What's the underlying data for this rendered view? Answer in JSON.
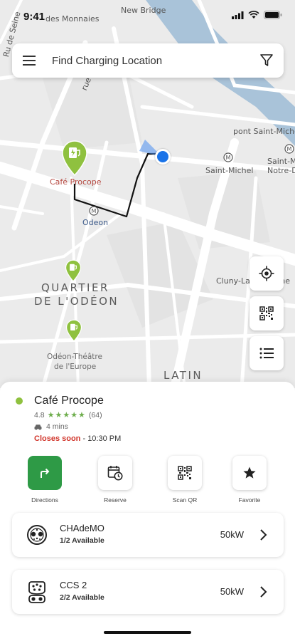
{
  "status": {
    "time": "9:41"
  },
  "search": {
    "placeholder": "Find Charging Location"
  },
  "map": {
    "labels": {
      "des_monnaies": "des Monnaies",
      "new_bridge": "New Bridge",
      "pont_saint_michel": "pont Saint-Michel",
      "saint_michel": "Saint-Michel",
      "notre_d": "Saint-Michel\nNotre-D",
      "rue_dauphine": "rue Dau",
      "rue_de_seine": "Ru de Seine",
      "cafe_procope": "Café Procope",
      "odeon": "Odeon",
      "quartier_1": "QUARTIER",
      "quartier_2": "DE L'ODÉON",
      "cluny": "Cluny-La Sorbonne",
      "odeon_theatre_1": "Odéon-Théâtre",
      "odeon_theatre_2": "de l'Europe",
      "latin": "LATIN"
    }
  },
  "location": {
    "title": "Café Procope",
    "rating": "4.8",
    "stars": "★★★★★",
    "reviews": "(64)",
    "drive_time": "4 mins",
    "closes_label": "Closes soon",
    "closes_time": "- 10:30 PM"
  },
  "actions": [
    {
      "label": "Directions",
      "icon": "directions-icon"
    },
    {
      "label": "Reserve",
      "icon": "calendar-clock-icon"
    },
    {
      "label": "Scan QR",
      "icon": "qr-code-icon"
    },
    {
      "label": "Favorite",
      "icon": "star-icon"
    }
  ],
  "connectors": [
    {
      "name": "CHAdeMO",
      "availability": "1/2 Available",
      "power": "50kW",
      "icon": "chademo-plug-icon"
    },
    {
      "name": "CCS 2",
      "availability": "2/2 Available",
      "power": "50kW",
      "icon": "ccs2-plug-icon"
    }
  ],
  "colors": {
    "primary_green": "#2e9a46",
    "pin_green": "#8fc13f",
    "closing_red": "#d1352b",
    "user_blue": "#1a73e8",
    "river": "#a9c3d9"
  }
}
